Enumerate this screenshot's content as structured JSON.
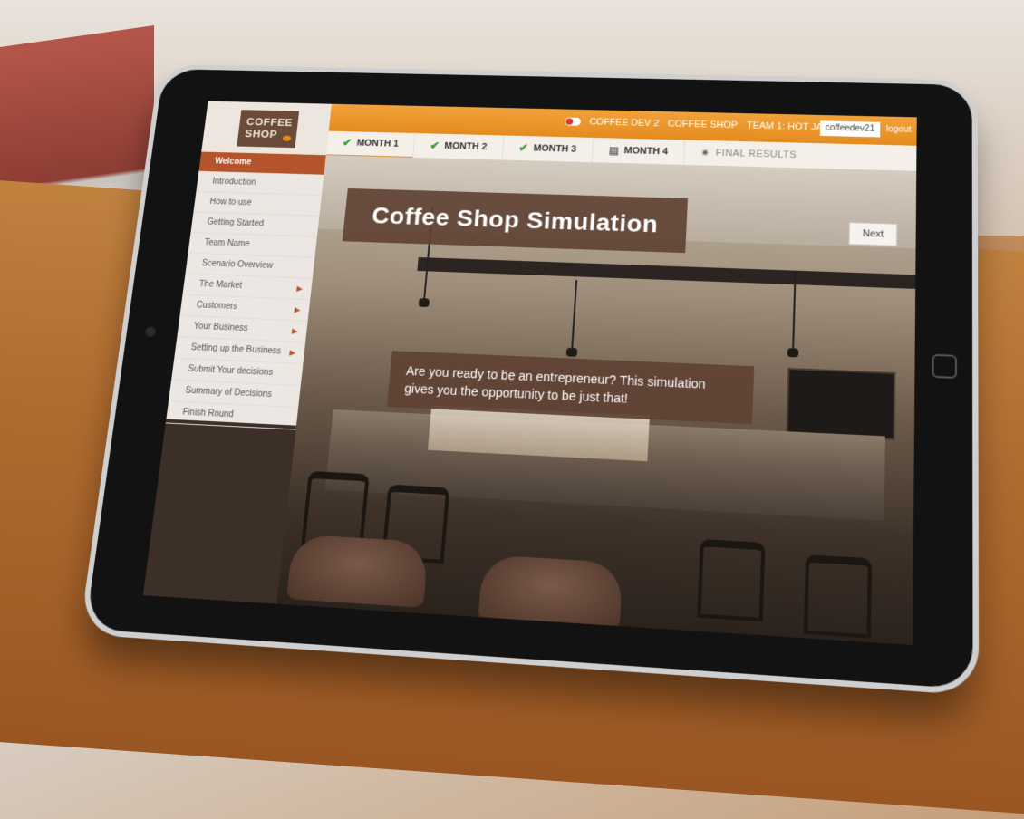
{
  "topbar": {
    "toggle_icon": "toggle-icon",
    "info": [
      "COFFEE DEV 2",
      "COFFEE SHOP",
      "TEAM 1: HOT JAVA"
    ],
    "username": "coffeedev21",
    "logout": "logout"
  },
  "logo": {
    "line1": "COFFEE",
    "line2": "SHOP"
  },
  "tabs": [
    {
      "label": "MONTH 1",
      "status": "complete"
    },
    {
      "label": "MONTH 2",
      "status": "complete"
    },
    {
      "label": "MONTH 3",
      "status": "complete"
    },
    {
      "label": "MONTH 4",
      "status": "in-progress"
    },
    {
      "label": "FINAL RESULTS",
      "status": "pending"
    }
  ],
  "sidebar": {
    "items": [
      {
        "label": "Welcome",
        "active": true,
        "has_submenu": false
      },
      {
        "label": "Introduction",
        "has_submenu": false
      },
      {
        "label": "How to use",
        "has_submenu": false
      },
      {
        "label": "Getting Started",
        "has_submenu": false
      },
      {
        "label": "Team Name",
        "has_submenu": false
      },
      {
        "label": "Scenario Overview",
        "has_submenu": false
      },
      {
        "label": "The Market",
        "has_submenu": true
      },
      {
        "label": "Customers",
        "has_submenu": true
      },
      {
        "label": "Your Business",
        "has_submenu": true
      },
      {
        "label": "Setting up the Business",
        "has_submenu": true
      },
      {
        "label": "Submit Your decisions",
        "has_submenu": false
      },
      {
        "label": "Summary of Decisions",
        "has_submenu": false
      },
      {
        "label": "Finish Round",
        "has_submenu": false
      }
    ]
  },
  "main": {
    "title": "Coffee Shop Simulation",
    "next_label": "Next",
    "message": "Are you ready to be an entrepreneur? This simulation gives you the opportunity to be just that!"
  },
  "colors": {
    "accent": "#e48b1f",
    "active_nav": "#b5532a",
    "banner": "#5f4234",
    "check": "#3a9a3a"
  }
}
